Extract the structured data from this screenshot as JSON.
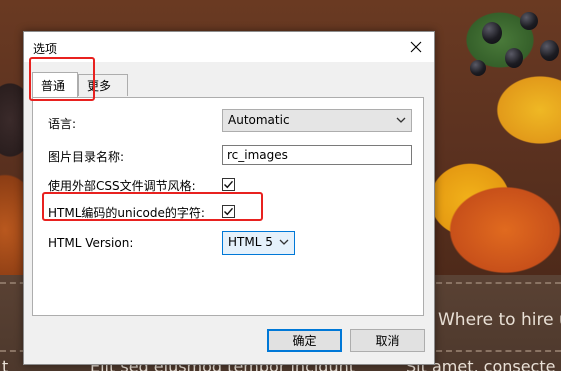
{
  "background": {
    "heading_text": "Where to hire u",
    "left_text": "Elit sed eiusmod tempor incidunt",
    "right_text": "Sit amet, consecte",
    "edge_char": "t",
    "colors": {
      "band": "#54402f",
      "wall": "#5c3220"
    }
  },
  "dialog": {
    "title": "选项",
    "close_icon": "close-icon",
    "tabs": [
      {
        "label": "普通",
        "selected": true
      },
      {
        "label": "更多",
        "selected": false
      }
    ],
    "rows": {
      "language": {
        "label": "语言:",
        "value": "Automatic"
      },
      "image_dir": {
        "label": "图片目录名称:",
        "value": "rc_images"
      },
      "external_css": {
        "label": "使用外部CSS文件调节风格:",
        "checked": true
      },
      "unicode_html": {
        "label": "HTML编码的unicode的字符:",
        "checked": true
      },
      "html_version": {
        "label": "HTML Version:",
        "value": "HTML 5"
      }
    },
    "buttons": {
      "ok": "确定",
      "cancel": "取消"
    }
  },
  "colors": {
    "highlight": "#e8211f",
    "focus": "#0078d7",
    "dialog_bg": "#f0f0f0"
  }
}
